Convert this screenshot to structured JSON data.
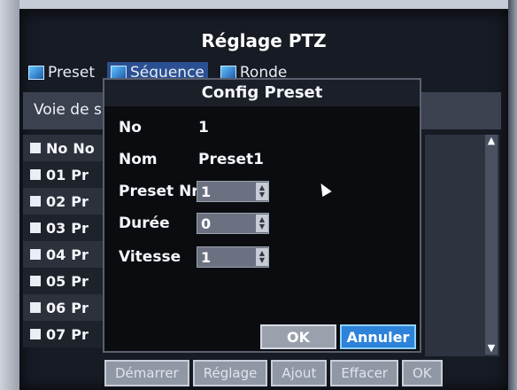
{
  "window": {
    "title": "Réglage PTZ"
  },
  "tabs": [
    {
      "label": "Preset",
      "icon": "preset-tab-icon"
    },
    {
      "label": "Séquence",
      "icon": "sequence-tab-icon"
    },
    {
      "label": "Ronde",
      "icon": "ronde-tab-icon"
    }
  ],
  "channel": {
    "label": "Voie de s"
  },
  "list": {
    "header": {
      "no": "No",
      "name": "No"
    },
    "rows": [
      {
        "no": "01",
        "name": "Pr"
      },
      {
        "no": "02",
        "name": "Pr"
      },
      {
        "no": "03",
        "name": "Pr"
      },
      {
        "no": "04",
        "name": "Pr"
      },
      {
        "no": "05",
        "name": "Pr"
      },
      {
        "no": "06",
        "name": "Pr"
      },
      {
        "no": "07",
        "name": "Pr"
      }
    ]
  },
  "bottom_buttons": [
    "Démarrer",
    "Réglage",
    "Ajout",
    "Effacer",
    "OK"
  ],
  "dialog": {
    "title": "Config Preset",
    "fields": {
      "no": {
        "label": "No",
        "value": "1"
      },
      "nom": {
        "label": "Nom",
        "value": "Preset1"
      },
      "preset_nr": {
        "label": "Preset Nr",
        "value": "1"
      },
      "duree": {
        "label": "Durée",
        "value": "0"
      },
      "vitesse": {
        "label": "Vitesse",
        "value": "1"
      }
    },
    "buttons": {
      "ok": "OK",
      "cancel": "Annuler"
    }
  }
}
